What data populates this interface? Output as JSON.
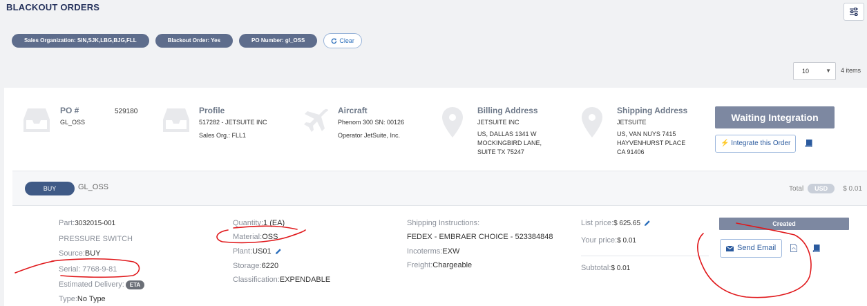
{
  "header": {
    "title": "BLACKOUT ORDERS",
    "filter_icon": "sliders-icon"
  },
  "filters": {
    "chips": [
      "Sales Organization: SIN,SJK,LBG,BJG,FLL",
      "Blackout Order: Yes",
      "PO Number: gl_OSS"
    ],
    "clear_label": "Clear"
  },
  "pagination": {
    "page_size": "10",
    "items_count": "4 items"
  },
  "order": {
    "po": {
      "heading": "PO #",
      "number": "529180",
      "value": "GL_OSS"
    },
    "profile": {
      "heading": "Profile",
      "line1": "517282 - JETSUITE INC",
      "line2": "Sales Org.: FLL1"
    },
    "aircraft": {
      "heading": "Aircraft",
      "line1": "Phenom 300 SN: 00126",
      "line2": "Operator JetSuite, Inc."
    },
    "billing": {
      "heading": "Billing Address",
      "line1": "JETSUITE INC",
      "line2": "US, DALLAS 1341 W",
      "line3": "MOCKINGBIRD LANE,",
      "line4": "SUITE TX 75247"
    },
    "shipping": {
      "heading": "Shipping Address",
      "line1": "JETSUITE",
      "line2": "US, VAN NUYS 7415",
      "line3": "HAYVENHURST PLACE",
      "line4": "CA 91406"
    },
    "status": "Waiting Integration",
    "integrate_label": "Integrate this Order"
  },
  "line_item": {
    "type": "BUY",
    "po_label": "GL_OSS",
    "total_label": "Total",
    "currency": "USD",
    "total_value": "$ 0.01",
    "part": {
      "label": "Part:",
      "value": "3032015-001"
    },
    "description": "PRESSURE SWITCH",
    "source": {
      "label": "Source:",
      "value": "BUY"
    },
    "serial": {
      "label": "Serial:",
      "value": "7768-9-81"
    },
    "estimated_delivery": {
      "label": "Estimated Delivery:",
      "badge": "ETA"
    },
    "type_field": {
      "label": "Type:",
      "value": "No Type"
    },
    "quantity": {
      "label": "Quantity:",
      "value": "1 (EA)"
    },
    "material": {
      "label": "Material:",
      "value": "OSS"
    },
    "plant": {
      "label": "Plant:",
      "value": "US01"
    },
    "storage": {
      "label": "Storage:",
      "value": "6220"
    },
    "classification": {
      "label": "Classification:",
      "value": "EXPENDABLE"
    },
    "shipping_instructions": {
      "label": "Shipping Instructions:",
      "value": "FEDEX - EMBRAER CHOICE - 523384848"
    },
    "incoterms": {
      "label": "Incoterms:",
      "value": "EXW"
    },
    "freight": {
      "label": "Freight:",
      "value": "Chargeable"
    },
    "list_price": {
      "label": "List price:",
      "value": "$ 625.65"
    },
    "your_price": {
      "label": "Your price:",
      "value": "$ 0.01"
    },
    "subtotal": {
      "label": "Subtotal:",
      "value": "$ 0.01"
    },
    "line_status": "Created",
    "send_email_label": "Send Email"
  },
  "colors": {
    "primary_navy": "#25325c",
    "chip_bg": "#5e6d8c",
    "status_gray": "#7d88a1",
    "annotation_red": "#e0181b",
    "link_blue": "#2a6ebb"
  }
}
